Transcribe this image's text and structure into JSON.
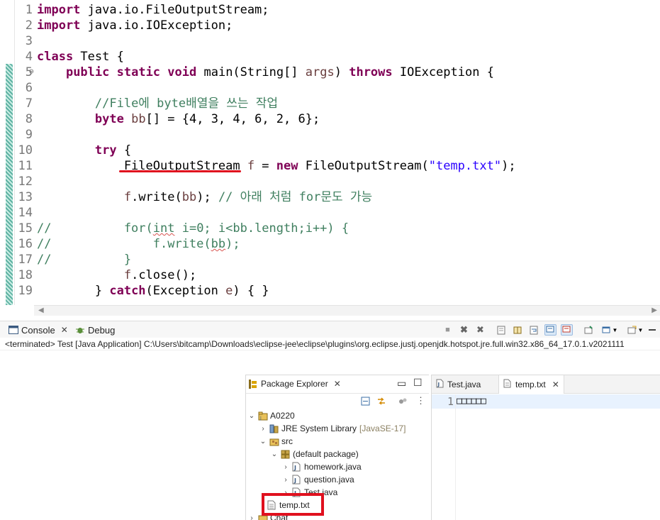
{
  "editor": {
    "lines": [
      {
        "n": "1",
        "html": "<span class='kw'>import</span> java.io.FileOutputStream;"
      },
      {
        "n": "2",
        "html": "<span class='kw'>import</span> java.io.IOException;"
      },
      {
        "n": "3",
        "html": ""
      },
      {
        "n": "4",
        "html": "<span class='kw'>class</span> Test {"
      },
      {
        "n": "5",
        "fold": "⊖",
        "html": "    <span class='kw'>public</span> <span class='kw'>static</span> <span class='kw'>void</span> main(String[] <span class='param'>args</span>) <span class='kw'>throws</span> IOException {"
      },
      {
        "n": "6",
        "html": ""
      },
      {
        "n": "7",
        "html": "        <span class='cmt'>//File에 byte배열을 쓰는 작업</span>"
      },
      {
        "n": "8",
        "html": "        <span class='kw'>byte</span> <span class='param'>bb</span>[] = {4, 3, 4, 6, 2, 6};"
      },
      {
        "n": "9",
        "html": ""
      },
      {
        "n": "10",
        "html": "        <span class='kw'>try</span> {"
      },
      {
        "n": "11",
        "html": "            FileOutputStream <span class='param'>f</span> = <span class='kw'>new</span> FileOutputStream(<span class='str'>\"temp.txt\"</span>);"
      },
      {
        "n": "12",
        "html": ""
      },
      {
        "n": "13",
        "html": "            <span class='param'>f</span>.write(<span class='param'>bb</span>); <span class='cmt'>// 아래 처럼 for문도 가능</span>"
      },
      {
        "n": "14",
        "html": ""
      },
      {
        "n": "15",
        "html": "<span class='cmt'>//          for(<span class='squiggle'>int</span> i=0; i&lt;bb.length;i++) {</span>"
      },
      {
        "n": "16",
        "html": "<span class='cmt'>//              f.write(<span class='squiggle'>bb</span>);</span>"
      },
      {
        "n": "17",
        "html": "<span class='cmt'>//          }</span>"
      },
      {
        "n": "18",
        "html": "            <span class='param'>f</span>.close();"
      },
      {
        "n": "19",
        "html": "        } <span class='kw'>catch</span>(Exception <span class='param'>e</span>) { }"
      }
    ]
  },
  "console": {
    "tab_console": "Console",
    "tab_debug": "Debug",
    "status": "<terminated> Test [Java Application] C:\\Users\\bitcamp\\Downloads\\eclipse-jee\\eclipse\\plugins\\org.eclipse.justj.openjdk.hotspot.jre.full.win32.x86_64_17.0.1.v2021111"
  },
  "package_explorer": {
    "title": "Package Explorer",
    "tree": {
      "project": "A0220",
      "jre": "JRE System Library",
      "jre_suffix": "[JavaSE-17]",
      "src": "src",
      "default_pkg": "(default package)",
      "homework": "homework.java",
      "question": "question.java",
      "test": "Test.java",
      "temp": "temp.txt",
      "chat": "Chat"
    }
  },
  "text_editor": {
    "tab_test": "Test.java",
    "tab_temp": "temp.txt",
    "line_number": "1",
    "content": "□□□□□□"
  }
}
